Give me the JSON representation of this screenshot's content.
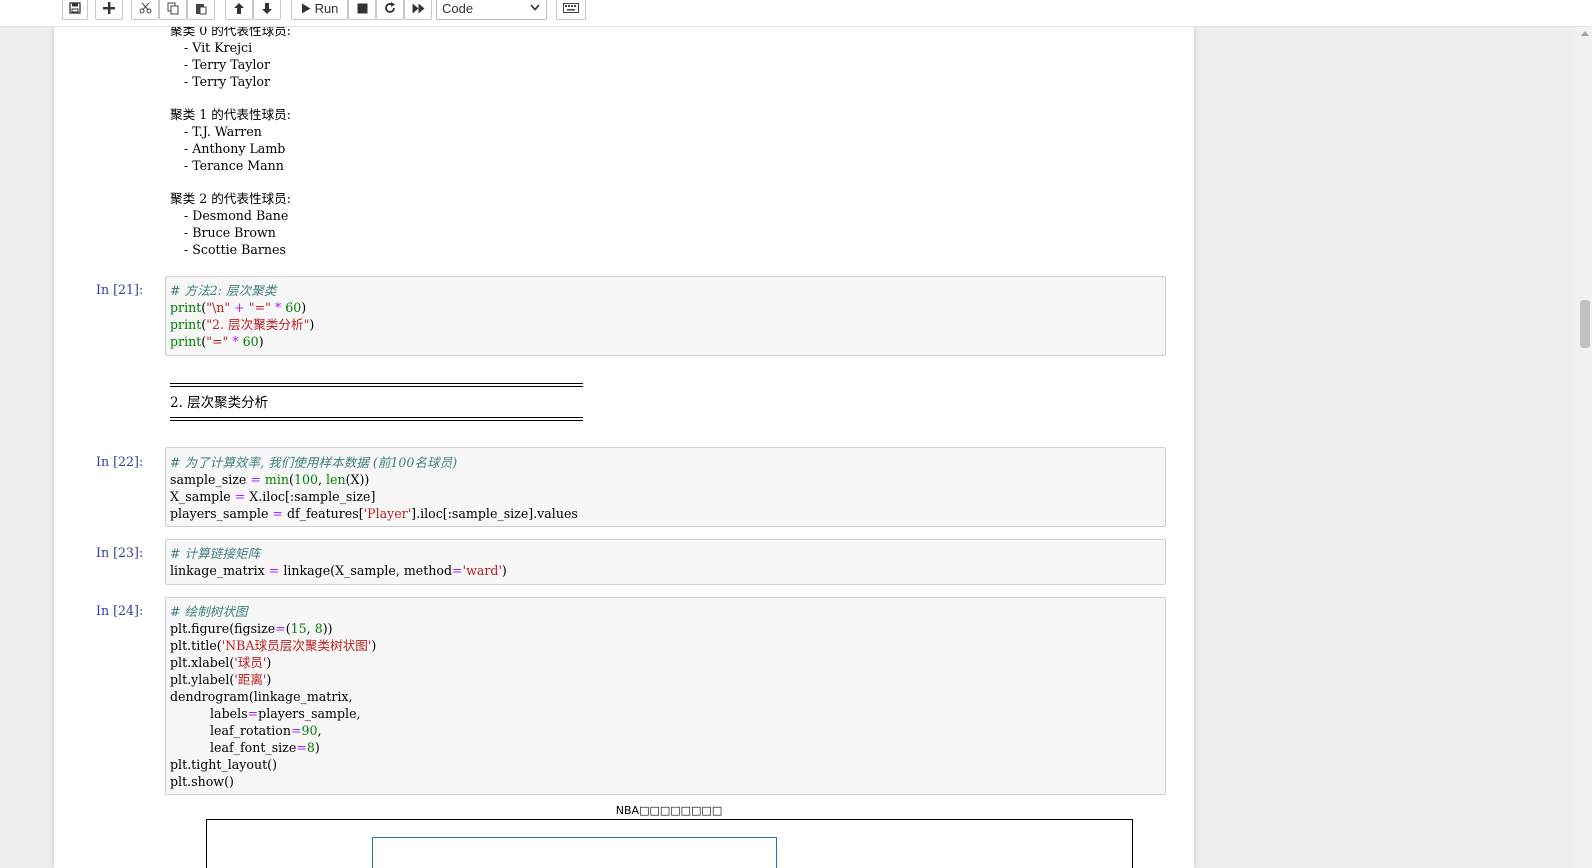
{
  "toolbar": {
    "run_label": "Run",
    "cell_type": "Code"
  },
  "output_clusters": [
    {
      "heading": "聚类 0 的代表性球员:",
      "players": [
        "- Vit Krejci",
        "- Terry Taylor",
        "- Terry Taylor"
      ]
    },
    {
      "heading": "聚类 1 的代表性球员:",
      "players": [
        "- T.J. Warren",
        "- Anthony Lamb",
        "- Terance Mann"
      ]
    },
    {
      "heading": "聚类 2 的代表性球员:",
      "players": [
        "- Desmond Bane",
        "- Bruce Brown",
        "- Scottie Barnes"
      ]
    }
  ],
  "cells": {
    "c21": {
      "prompt": "In [21]:",
      "comment": "# 方法2: 层次聚类",
      "l2": {
        "fn": "print",
        "p1": "(",
        "s1": "\"\\n\"",
        "op1": " + ",
        "s2": "\"=\"",
        "op2": " * ",
        "n1": "60",
        "p2": ")"
      },
      "l3": {
        "fn": "print",
        "p1": "(",
        "s1": "\"2. 层次聚类分析\"",
        "p2": ")"
      },
      "l4": {
        "fn": "print",
        "p1": "(",
        "s1": "\"=\"",
        "op1": " * ",
        "n1": "60",
        "p2": ")"
      }
    },
    "c21_output": {
      "title": "2. 层次聚类分析"
    },
    "c22": {
      "prompt": "In [22]:",
      "comment": "# 为了计算效率, 我们使用样本数据 (前100名球员)",
      "l2": {
        "a": "sample_size ",
        "op": "=",
        "b": " ",
        "fn": "min",
        "c": "(",
        "n": "100",
        "d": ", ",
        "fn2": "len",
        "e": "(X))"
      },
      "l3": {
        "a": "X_sample ",
        "op": "=",
        "b": " X.iloc[:sample_size]"
      },
      "l4": {
        "a": "players_sample ",
        "op": "=",
        "b": " df_features[",
        "s": "'Player'",
        "c": "].iloc[:sample_size].values"
      }
    },
    "c23": {
      "prompt": "In [23]:",
      "comment": "# 计算链接矩阵",
      "l2": {
        "a": "linkage_matrix ",
        "op": "=",
        "b": " linkage(X_sample, method",
        "op2": "=",
        "s": "'ward'",
        "c": ")"
      }
    },
    "c24": {
      "prompt": "In [24]:",
      "comment": "# 绘制树状图",
      "l2": {
        "a": "plt.figure(figsize",
        "op": "=",
        "b": "(",
        "n1": "15",
        "c": ", ",
        "n2": "8",
        "d": "))"
      },
      "l3": {
        "a": "plt.title(",
        "s": "'NBA球员层次聚类树状图'",
        "b": ")"
      },
      "l4": {
        "a": "plt.xlabel(",
        "s": "'球员'",
        "b": ")"
      },
      "l5": {
        "a": "plt.ylabel(",
        "s": "'距离'",
        "b": ")"
      },
      "l6": {
        "a": "dendrogram(linkage_matrix,"
      },
      "l7": {
        "a": "          labels",
        "op": "=",
        "b": "players_sample,"
      },
      "l8": {
        "a": "          leaf_rotation",
        "op": "=",
        "n": "90",
        "b": ","
      },
      "l9": {
        "a": "          leaf_font_size",
        "op": "=",
        "n": "8",
        "b": ")"
      },
      "l10": {
        "a": "plt.tight_layout()"
      },
      "l11": {
        "a": "plt.show()"
      }
    }
  },
  "figure": {
    "title": "NBA□□□□□□□□"
  }
}
